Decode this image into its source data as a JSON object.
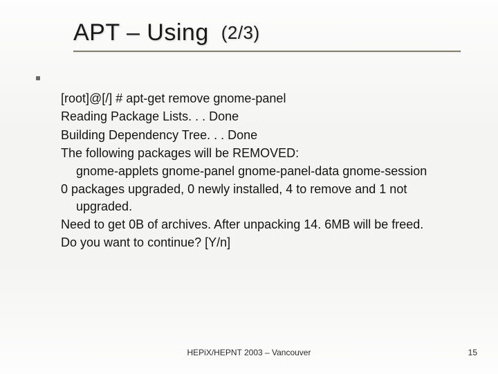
{
  "title_main": "APT – Using",
  "title_part": "(2/3)",
  "lines": [
    {
      "t": "[root]@[/] # apt-get remove gnome-panel",
      "ind": false
    },
    {
      "t": "Reading Package Lists. . . Done",
      "ind": false
    },
    {
      "t": "Building Dependency Tree. . . Done",
      "ind": false
    },
    {
      "t": "The following packages will be REMOVED:",
      "ind": false
    },
    {
      "t": "gnome-applets gnome-panel gnome-panel-data gnome-session",
      "ind": true
    },
    {
      "t": "0 packages upgraded, 0 newly installed, 4 to remove and 1  not upgraded.",
      "ind": false,
      "wrap": true
    },
    {
      "t": "Need to get 0B of archives. After unpacking 14. 6MB will be freed.",
      "ind": false
    },
    {
      "t": "Do you want to continue? [Y/n]",
      "ind": false
    }
  ],
  "footer": "HEPiX/HEPNT 2003 – Vancouver",
  "page_number": "15"
}
